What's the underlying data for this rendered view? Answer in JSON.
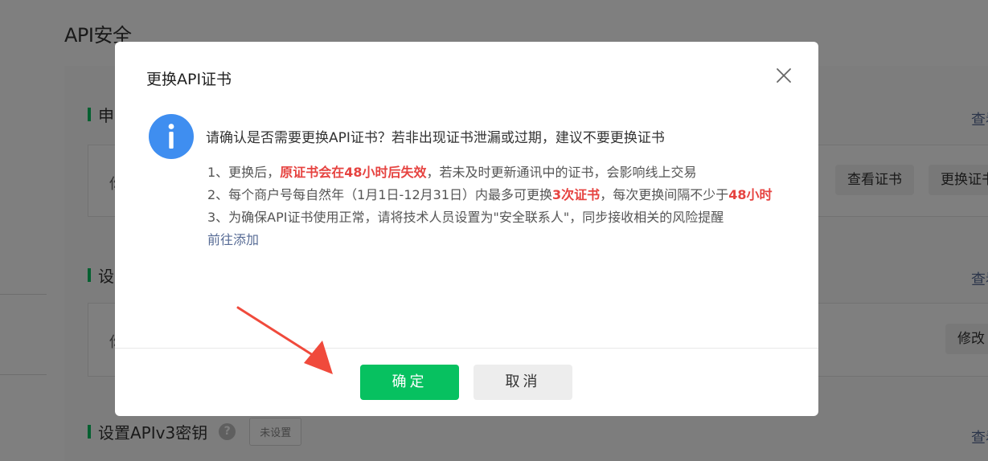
{
  "page": {
    "title": "API安全",
    "sections": [
      {
        "title": "申",
        "card_text": "你",
        "buttons": [
          "查看证书",
          "更换证书"
        ],
        "link": "查看"
      },
      {
        "title": "设",
        "card_text": "你",
        "buttons": [
          "修改"
        ],
        "link": "查看"
      },
      {
        "title": "设置APIv3密钥",
        "help": "?",
        "status": "未设置",
        "link": "查看"
      }
    ]
  },
  "modal": {
    "title": "更换API证书",
    "close_icon": "close-icon",
    "info_icon": "info-icon",
    "headline": "请确认是否需要更换API证书？若非出现证书泄漏或过期，建议不要更换证书",
    "line1": {
      "prefix": "1、更换后，",
      "highlight": "原证书会在48小时后失效",
      "suffix": "，若未及时更新通讯中的证书，会影响线上交易"
    },
    "line2": {
      "prefix": "2、每个商户号每自然年（1月1日-12月31日）内最多可更换",
      "highlight1": "3次证书",
      "middle": "，每次更换间隔不少于",
      "highlight2": "48小时"
    },
    "line3": {
      "text": "3、为确保API证书使用正常，请将技术人员设置为\"安全联系人\"，同步接收相关的风险提醒"
    },
    "link": "前往添加",
    "confirm_label": "确定",
    "cancel_label": "取消"
  },
  "colors": {
    "accent": "#07c160",
    "highlight": "#e64340",
    "link": "#576b95",
    "info_blue": "#3f8ef0",
    "arrow": "#f04a3c"
  }
}
